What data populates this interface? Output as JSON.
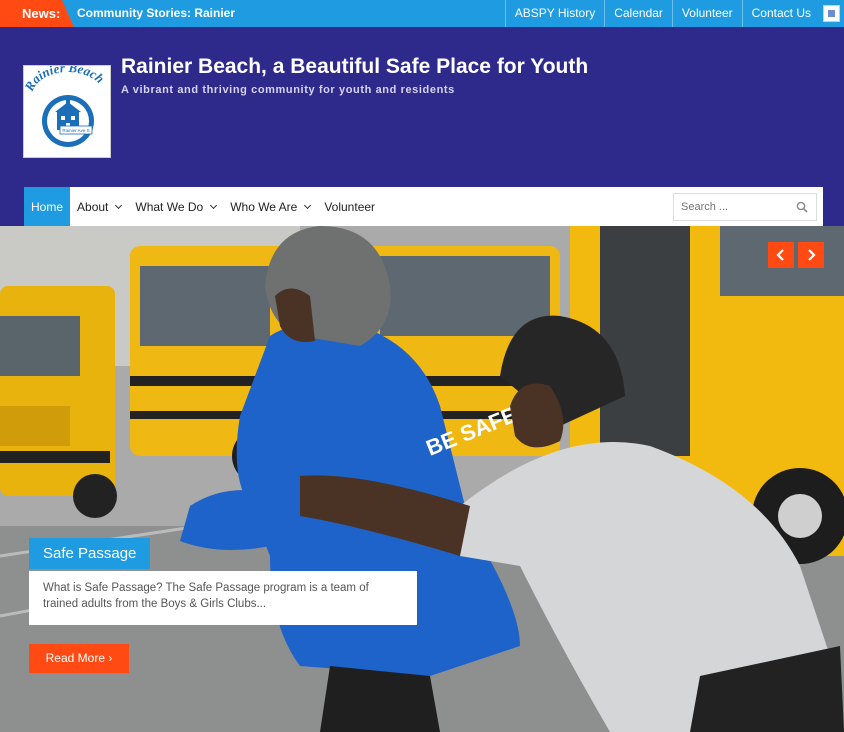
{
  "topbar": {
    "news_label": "News:",
    "ticker_text": "Community Stories: Rainier",
    "links": [
      "ABSPY History",
      "Calendar",
      "Volunteer",
      "Contact Us"
    ]
  },
  "header": {
    "logo_text": "Rainier Beach",
    "logo_sign": "Rainier Ave S",
    "title": "Rainier Beach, a Beautiful Safe Place for Youth",
    "tagline": "A vibrant and thriving community for youth and residents"
  },
  "nav": {
    "items": [
      {
        "label": "Home",
        "active": true,
        "dropdown": false
      },
      {
        "label": "About",
        "active": false,
        "dropdown": true
      },
      {
        "label": "What We Do",
        "active": false,
        "dropdown": true
      },
      {
        "label": "Who We Are",
        "active": false,
        "dropdown": true
      },
      {
        "label": "Volunteer",
        "active": false,
        "dropdown": false
      }
    ],
    "search_placeholder": "Search ...",
    "search_icon": "search-icon"
  },
  "slider": {
    "prev_icon": "chevron-left-icon",
    "next_icon": "chevron-right-icon",
    "title": "Safe Passage",
    "excerpt": "What is Safe Passage?  The Safe Passage program is a team of trained adults from the Boys & Girls Clubs...",
    "read_more": "Read More",
    "jacket_text": "BE SAFE"
  },
  "colors": {
    "header_bg": "#2e2a8c",
    "accent_blue": "#1e9be1",
    "accent_orange": "#ff4a14"
  }
}
